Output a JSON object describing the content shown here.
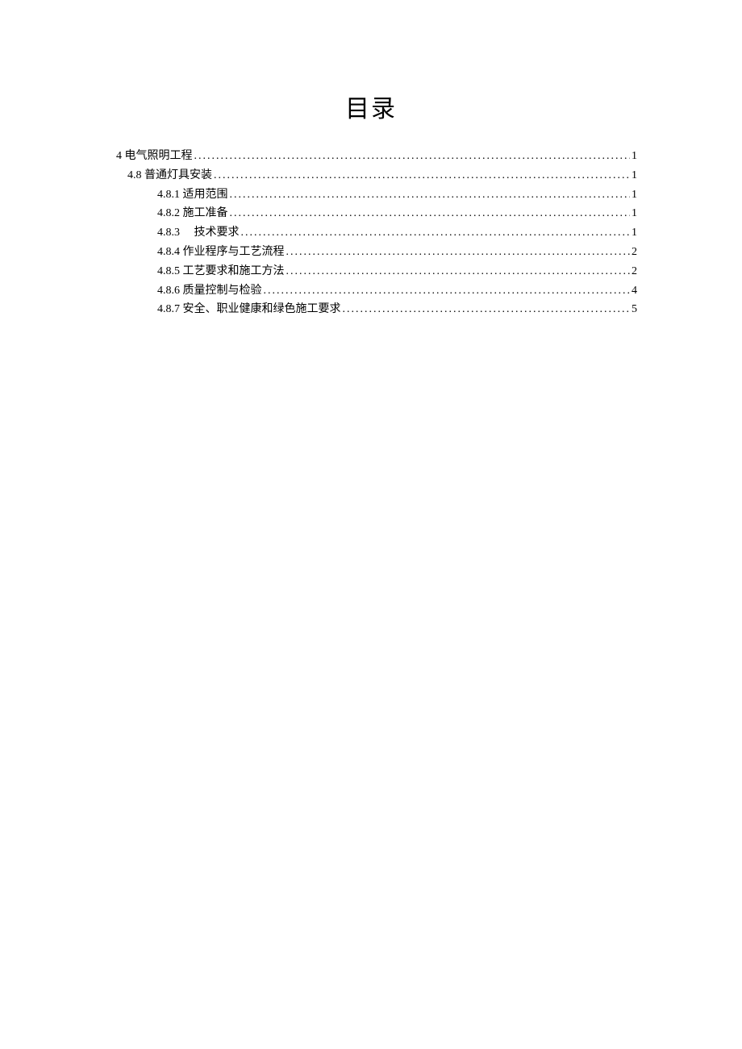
{
  "title": "目录",
  "toc": {
    "entries": [
      {
        "level": 1,
        "label": "4 电气照明工程",
        "page": "1"
      },
      {
        "level": 2,
        "label": "4.8 普通灯具安装",
        "page": "1"
      },
      {
        "level": 3,
        "label": "4.8.1 适用范围 ",
        "page": "1"
      },
      {
        "level": 3,
        "label": "4.8.2 施工准备 ",
        "page": "1"
      },
      {
        "level": 3,
        "label": "4.8.3 　技术要求 ",
        "page": "1"
      },
      {
        "level": 3,
        "label": "4.8.4 作业程序与工艺流程 ",
        "page": "2"
      },
      {
        "level": 3,
        "label": "4.8.5 工艺要求和施工方法 ",
        "page": "2"
      },
      {
        "level": 3,
        "label": "4.8.6 质量控制与检验 ",
        "page": "4"
      },
      {
        "level": 3,
        "label": "4.8.7 安全、职业健康和绿色施工要求 ",
        "page": "5"
      }
    ]
  }
}
